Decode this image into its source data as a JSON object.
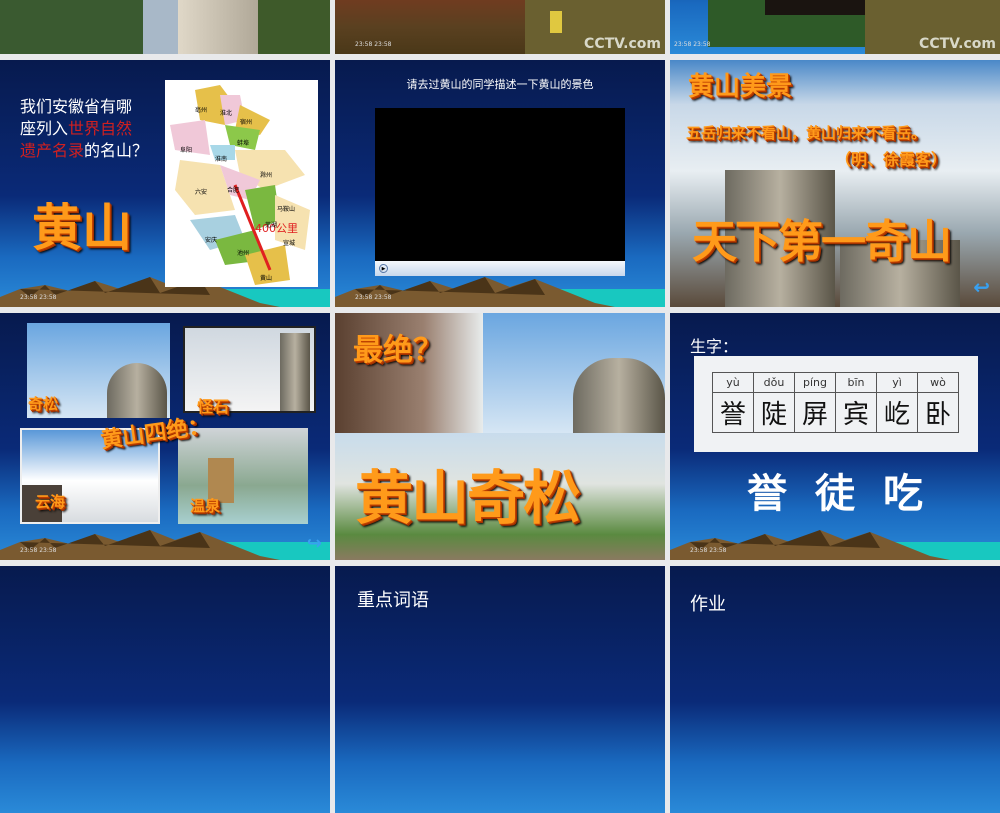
{
  "timestamp": "23:58 23:58",
  "slide_top_right": {
    "logo": "CCTV.com"
  },
  "slide_map": {
    "question_a": "我们安徽省有哪",
    "question_b": "座列入",
    "question_hl1": "世界自然",
    "question_hl2": "遗产名录",
    "question_c": "的名山？",
    "answer": "黄山",
    "distance": "400公里",
    "cities": [
      "亳州",
      "淮北",
      "宿州",
      "阜阳",
      "蚌埠",
      "淮南",
      "滁州",
      "六安",
      "合肥",
      "芜湖",
      "马鞍山",
      "安庆",
      "池州",
      "宣城",
      "黄山"
    ]
  },
  "slide_video": {
    "title": "请去过黄山的同学描述一下黄山的景色"
  },
  "slide_scenery": {
    "title": "黄山美景",
    "quote": "五岳归来不看山，黄山归来不看岳。",
    "author": "（明、徐霞客）",
    "slogan": "天下第一奇山"
  },
  "slide_four": {
    "title": "黄山四绝：",
    "items": [
      "奇松",
      "怪石",
      "云海",
      "温泉"
    ]
  },
  "slide_pine": {
    "question": "最绝？",
    "answer": "黄山奇松"
  },
  "slide_chars": {
    "label": "生字：",
    "pinyin": [
      "yù",
      "dǒu",
      "píng",
      "bīn",
      "yì",
      "wò"
    ],
    "chars": [
      "誉",
      "陡",
      "屏",
      "宾",
      "屹",
      "卧"
    ],
    "focus": [
      "誉",
      "徒",
      "吃"
    ]
  },
  "slide_words": {
    "title": "重点词语"
  },
  "slide_homework": {
    "title": "作业"
  }
}
